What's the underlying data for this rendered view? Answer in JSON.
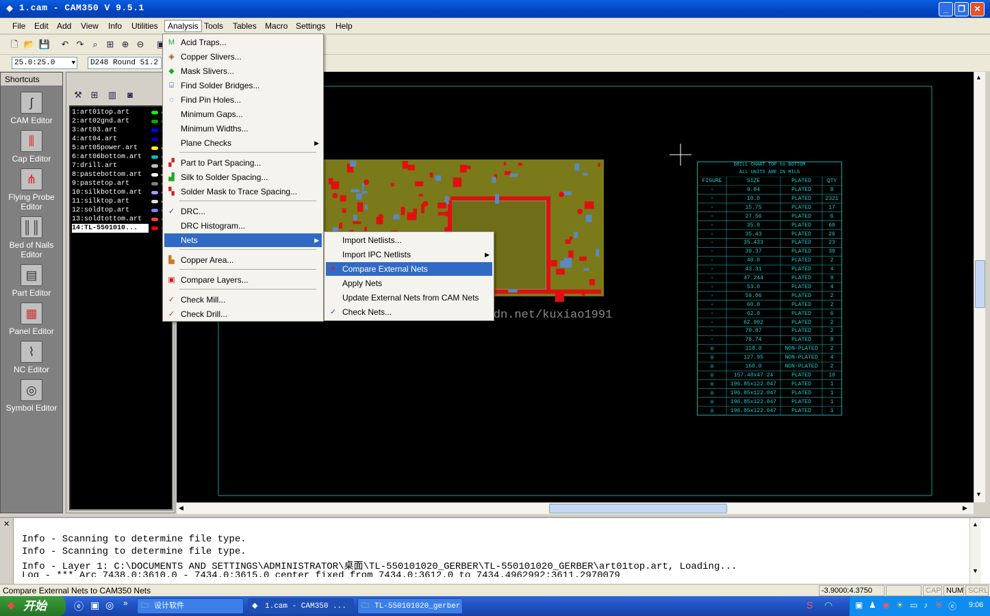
{
  "window": {
    "title": "1.cam - CAM350 V 9.5.1"
  },
  "menubar": [
    "File",
    "Edit",
    "Add",
    "View",
    "Info",
    "Utilities",
    "Analysis",
    "Tools",
    "Tables",
    "Macro",
    "Settings",
    "Help"
  ],
  "toolbar": {
    "zoom_value": "25.0:25.0",
    "dcode_value": "D248  Round 51.2"
  },
  "shortcuts": {
    "header": "Shortcuts",
    "items": [
      {
        "label": "CAM Editor",
        "icon": "cam-editor-icon"
      },
      {
        "label": "Cap Editor",
        "icon": "cap-editor-icon"
      },
      {
        "label": "Flying Probe Editor",
        "icon": "flying-probe-icon"
      },
      {
        "label": "Bed of Nails Editor",
        "icon": "bed-of-nails-icon"
      },
      {
        "label": "Part Editor",
        "icon": "part-editor-icon"
      },
      {
        "label": "Panel Editor",
        "icon": "panel-editor-icon"
      },
      {
        "label": "NC Editor",
        "icon": "nc-editor-icon"
      },
      {
        "label": "Symbol Editor",
        "icon": "symbol-editor-icon"
      }
    ]
  },
  "layers": [
    {
      "name": "1:art01top.art",
      "color": "#00ff00"
    },
    {
      "name": "2:art02gnd.art",
      "color": "#00b000"
    },
    {
      "name": "3:art03.art",
      "color": "#0000ff"
    },
    {
      "name": "4:art04.art",
      "color": "#0000c0"
    },
    {
      "name": "5:art05power.art",
      "color": "#ffff00"
    },
    {
      "name": "6:art06bottom.art",
      "color": "#00c0c0"
    },
    {
      "name": "7:drill.art",
      "color": "#c0c0c0"
    },
    {
      "name": "8:pastebottom.art",
      "color": "#ffffff"
    },
    {
      "name": "9:pastetop.art",
      "color": "#808080"
    },
    {
      "name": "10:silkbottom.art",
      "color": "#a0a0ff"
    },
    {
      "name": "11:silktop.art",
      "color": "#e0e0e0"
    },
    {
      "name": "12:soldtop.art",
      "color": "#8080ff"
    },
    {
      "name": "13:soldtottom.art",
      "color": "#ff4040"
    },
    {
      "name": "14:TL-5501010...",
      "color": "#ff0000"
    }
  ],
  "analysis_menu": [
    {
      "label": "Acid Traps...",
      "icon": "acid-traps-icon"
    },
    {
      "label": "Copper Slivers...",
      "icon": "copper-slivers-icon"
    },
    {
      "label": "Mask Slivers...",
      "icon": "mask-slivers-icon"
    },
    {
      "label": "Find Solder Bridges...",
      "icon": "solder-bridges-icon"
    },
    {
      "label": "Find Pin Holes...",
      "icon": "pin-holes-icon"
    },
    {
      "label": "Minimum Gaps...",
      "icon": ""
    },
    {
      "label": "Minimum Widths...",
      "icon": ""
    },
    {
      "label": "Plane Checks",
      "icon": "",
      "submenu": true
    },
    {
      "label": "Part to Part Spacing...",
      "icon": "part-spacing-icon"
    },
    {
      "label": "Silk to Solder Spacing...",
      "icon": "silk-solder-icon"
    },
    {
      "label": "Solder Mask to Trace Spacing...",
      "icon": "mask-trace-icon"
    },
    {
      "label": "DRC...",
      "icon": "drc-icon"
    },
    {
      "label": "DRC Histogram...",
      "icon": ""
    },
    {
      "label": "Nets",
      "icon": "",
      "submenu": true
    },
    {
      "label": "Copper Area...",
      "icon": "copper-area-icon"
    },
    {
      "label": "Compare Layers...",
      "icon": "compare-layers-icon"
    },
    {
      "label": "Check Mill...",
      "icon": "check-mill-icon"
    },
    {
      "label": "Check Drill...",
      "icon": "check-drill-icon"
    }
  ],
  "nets_menu": [
    {
      "label": "Import Netlists...",
      "icon": ""
    },
    {
      "label": "Import IPC Netlists",
      "icon": "",
      "submenu": true
    },
    {
      "label": "Compare External Nets",
      "icon": "compare-nets-icon"
    },
    {
      "label": "Apply Nets",
      "icon": ""
    },
    {
      "label": "Update External Nets from CAM Nets",
      "icon": ""
    },
    {
      "label": "Check Nets...",
      "icon": "check-nets-icon"
    }
  ],
  "watermark": "http://blog.csdn.net/kuxiao1991",
  "drill_chart": {
    "title": "DRILL CHART  TOP to BOTTOM",
    "subtitle": "ALL UNITS ARE IN MILS",
    "headers": [
      "FIGURE",
      "SIZE",
      "PLATED",
      "QTY"
    ],
    "rows": [
      [
        "9.84",
        "PLATED",
        "8"
      ],
      [
        "10.0",
        "PLATED",
        "2321"
      ],
      [
        "15.75",
        "PLATED",
        "17"
      ],
      [
        "27.56",
        "PLATED",
        "6"
      ],
      [
        "35.0",
        "PLATED",
        "60"
      ],
      [
        "35.43",
        "PLATED",
        "26"
      ],
      [
        "35.433",
        "PLATED",
        "23"
      ],
      [
        "39.37",
        "PLATED",
        "30"
      ],
      [
        "40.0",
        "PLATED",
        "2"
      ],
      [
        "43.31",
        "PLATED",
        "4"
      ],
      [
        "47.244",
        "PLATED",
        "9"
      ],
      [
        "53.0",
        "PLATED",
        "4"
      ],
      [
        "59.06",
        "PLATED",
        "2"
      ],
      [
        "60.0",
        "PLATED",
        "2"
      ],
      [
        "62.0",
        "PLATED",
        "6"
      ],
      [
        "62.992",
        "PLATED",
        "2"
      ],
      [
        "70.87",
        "PLATED",
        "2"
      ],
      [
        "78.74",
        "PLATED",
        "8"
      ],
      [
        "118.0",
        "NON-PLATED",
        "2"
      ],
      [
        "127.95",
        "NON-PLATED",
        "4"
      ],
      [
        "160.0",
        "NON-PLATED",
        "2"
      ],
      [
        "157.48x47.24",
        "PLATED",
        "10"
      ],
      [
        "196.85x122.047",
        "PLATED",
        "1"
      ],
      [
        "196.85x122.047",
        "PLATED",
        "1"
      ],
      [
        "196.85x122.047",
        "PLATED",
        "1"
      ],
      [
        "196.85x122.047",
        "PLATED",
        "1"
      ]
    ]
  },
  "log": [
    "Info - Scanning to determine file type.",
    "Info - Scanning to determine file type.",
    "Info - Layer 1: C:\\DOCUMENTS AND SETTINGS\\ADMINISTRATOR\\桌面\\TL-550101020_GERBER\\TL-550101020_GERBER\\art01top.art, Loading...",
    "Log - *** Arc 7438.0:3610.0 - 7434.0:3615.0 center fixed from 7434.0:3612.0 to 7434.4962992:3611.2970079"
  ],
  "status": {
    "message": "Compare External Nets to CAM350 Nets",
    "coords": "-3.9000:4.3750",
    "cap": "CAP",
    "num": "NUM",
    "scrl": "SCRL"
  },
  "taskbar": {
    "start": "开始",
    "tasks": [
      "设计软件",
      "1.cam - CAM350 ...",
      "TL-550101020_gerber"
    ],
    "clock": "9:06"
  },
  "colors": {
    "highlight": "#316ac5",
    "pcb_board": "#7a7a1a",
    "pcb_copper": "#e01010",
    "drill_chart": "#22cccc"
  }
}
